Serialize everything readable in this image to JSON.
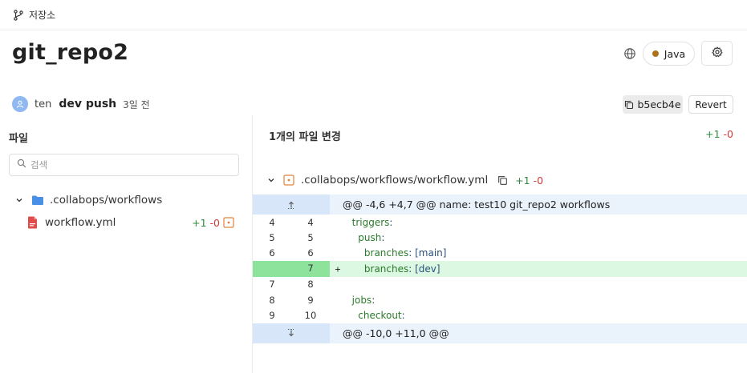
{
  "breadcrumb": {
    "label": "저장소"
  },
  "repo": {
    "name": "git_repo2",
    "language": "Java",
    "language_color": "#b07219"
  },
  "commit": {
    "author": "ten",
    "message": "dev push",
    "time": "3일 전",
    "sha": "b5ecb4e",
    "revert_label": "Revert"
  },
  "files_panel": {
    "title": "파일",
    "search_placeholder": "검색",
    "folder": ".collabops/workflows",
    "file": {
      "name": "workflow.yml",
      "additions": "+1",
      "deletions": "-0"
    }
  },
  "changes": {
    "title": "1개의 파일 변경",
    "additions": "+1",
    "deletions": "-0",
    "file_path": ".collabops/workflows/workflow.yml",
    "file_additions": "+1",
    "file_deletions": "-0"
  },
  "diff": {
    "hunk_top": "@@ -4,6 +4,7 @@ name: test10 git_repo2 workflows",
    "hunk_bottom": "@@ -10,0 +11,0 @@",
    "lines": [
      {
        "old": "4",
        "new": "4",
        "sign": "",
        "key": "triggers",
        "sep": ":",
        "value": "",
        "indent": "  ",
        "type": "context"
      },
      {
        "old": "5",
        "new": "5",
        "sign": "",
        "key": "push",
        "sep": ":",
        "value": "",
        "indent": "    ",
        "type": "context"
      },
      {
        "old": "6",
        "new": "6",
        "sign": "",
        "key": "branches",
        "sep": ":",
        "value": " [main]",
        "indent": "      ",
        "type": "context"
      },
      {
        "old": "",
        "new": "7",
        "sign": "+",
        "key": "branches",
        "sep": ":",
        "value": " [dev]",
        "indent": "      ",
        "type": "added"
      },
      {
        "old": "7",
        "new": "8",
        "sign": "",
        "key": "",
        "sep": "",
        "value": "",
        "indent": "",
        "type": "context"
      },
      {
        "old": "8",
        "new": "9",
        "sign": "",
        "key": "jobs",
        "sep": ":",
        "value": "",
        "indent": "  ",
        "type": "context"
      },
      {
        "old": "9",
        "new": "10",
        "sign": "",
        "key": "checkout",
        "sep": ":",
        "value": "",
        "indent": "    ",
        "type": "context"
      }
    ]
  },
  "colors": {
    "addition": "#2e8b3d",
    "deletion": "#d23a3a",
    "added_row": "#dcf8e2",
    "added_gutter": "#8ee39c",
    "hunk_row": "#eaf2fc"
  },
  "icons": [
    "branch-icon",
    "globe-icon",
    "gear-icon",
    "user-icon",
    "copy-icon",
    "search-icon",
    "chevron-down-icon",
    "folder-icon",
    "file-yml-icon",
    "modified-icon",
    "expand-up-icon",
    "expand-down-icon"
  ]
}
